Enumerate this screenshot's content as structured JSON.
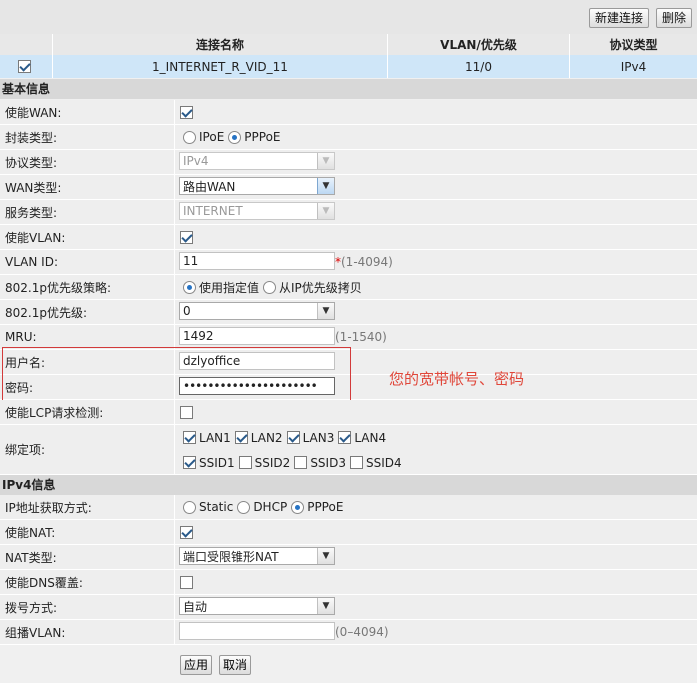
{
  "toolbar": {
    "new_label": "新建连接",
    "delete_label": "删除"
  },
  "connections": {
    "headers": [
      "连接名称",
      "VLAN/优先级",
      "协议类型"
    ],
    "rows": [
      {
        "checked": true,
        "name": "1_INTERNET_R_VID_11",
        "vlan": "11/0",
        "protocol": "IPv4"
      }
    ]
  },
  "basic": {
    "title": "基本信息",
    "enable_wan": {
      "label": "使能WAN:",
      "checked": true
    },
    "encap": {
      "label": "封装类型:",
      "options": [
        "IPoE",
        "PPPoE"
      ],
      "selected": "PPPoE"
    },
    "protocol": {
      "label": "协议类型:",
      "value": "IPv4"
    },
    "wan_type": {
      "label": "WAN类型:",
      "value": "路由WAN"
    },
    "service_type": {
      "label": "服务类型:",
      "value": "INTERNET"
    },
    "enable_vlan": {
      "label": "使能VLAN:",
      "checked": true
    },
    "vlan_id": {
      "label": "VLAN ID:",
      "value": "11",
      "required": "*",
      "hint": "(1-4094)"
    },
    "priority_policy": {
      "label": "802.1p优先级策略:",
      "options": [
        "使用指定值",
        "从IP优先级拷贝"
      ],
      "selected": "使用指定值"
    },
    "priority": {
      "label": "802.1p优先级:",
      "value": "0"
    },
    "mru": {
      "label": "MRU:",
      "value": "1492",
      "hint": "(1-1540)"
    },
    "username": {
      "label": "用户名:",
      "value": "dzlyoffice"
    },
    "password": {
      "label": "密码:",
      "value": "••••••••••••••••••••••"
    },
    "annotation": "您的宽带帐号、密码",
    "lcp": {
      "label": "使能LCP请求检测:",
      "checked": false
    },
    "binding": {
      "label": "绑定项:",
      "items": [
        {
          "name": "LAN1",
          "checked": true
        },
        {
          "name": "LAN2",
          "checked": true
        },
        {
          "name": "LAN3",
          "checked": true
        },
        {
          "name": "LAN4",
          "checked": true
        },
        {
          "name": "SSID1",
          "checked": true
        },
        {
          "name": "SSID2",
          "checked": false
        },
        {
          "name": "SSID3",
          "checked": false
        },
        {
          "name": "SSID4",
          "checked": false
        }
      ]
    }
  },
  "ipv4": {
    "title": "IPv4信息",
    "addr_mode": {
      "label": "IP地址获取方式:",
      "options": [
        "Static",
        "DHCP",
        "PPPoE"
      ],
      "selected": "PPPoE"
    },
    "enable_nat": {
      "label": "使能NAT:",
      "checked": true
    },
    "nat_type": {
      "label": "NAT类型:",
      "value": "端口受限锥形NAT"
    },
    "dns_override": {
      "label": "使能DNS覆盖:",
      "checked": false
    },
    "dial_mode": {
      "label": "拨号方式:",
      "value": "自动"
    },
    "multicast_vlan": {
      "label": "组播VLAN:",
      "value": "",
      "hint": "(0–4094)"
    }
  },
  "footer": {
    "apply_label": "应用",
    "cancel_label": "取消"
  },
  "colors": {
    "selected_row": "#cfe6f8",
    "annotation": "#e0473a",
    "radio_dot": "#2673c4"
  }
}
